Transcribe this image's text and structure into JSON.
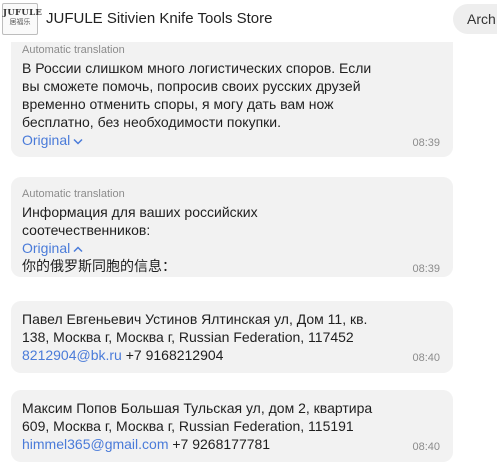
{
  "header": {
    "logo_top": "JUFULE",
    "logo_bottom": "居福乐",
    "store_name": "JUFULE Sitivien Knife Tools Store",
    "archive_label": "Arch"
  },
  "messages": [
    {
      "label": "Automatic translation",
      "lines": [
        "В России слишком много логистических споров. Если",
        "вы сможете помочь, попросив своих русских друзей",
        "временно отменить споры, я могу дать вам нож",
        "бесплатно, без необходимости покупки."
      ],
      "toggle": "Original",
      "toggle_icon": "chevron-down-icon",
      "time": "08:39"
    },
    {
      "label": "Automatic translation",
      "lines": [
        "Информация для ваших российских",
        "соотечественников:"
      ],
      "toggle": "Original",
      "toggle_icon": "chevron-up-icon",
      "original": "你的俄罗斯同胞的信息：",
      "time": "08:39"
    },
    {
      "lines": [
        "Павел Евгеньевич Устинов Ялтинская ул, Дом 11, кв.",
        "138, Москва г, Москва г, Russian Federation, 117452"
      ],
      "email": "8212904@bk.ru",
      "phone": " +7 9168212904",
      "time": "08:40"
    },
    {
      "lines": [
        "Максим Попов Большая Тульская ул, дом 2, квартира",
        "609, Москва г, Москва г, Russian Federation, 115191"
      ],
      "email": "himmel365@gmail.com",
      "phone": " +7 9268177781",
      "time": "08:40"
    }
  ],
  "colors": {
    "bubble_bg": "#f2f2f2",
    "link": "#4a7bd9",
    "muted": "#8c8c8c"
  }
}
